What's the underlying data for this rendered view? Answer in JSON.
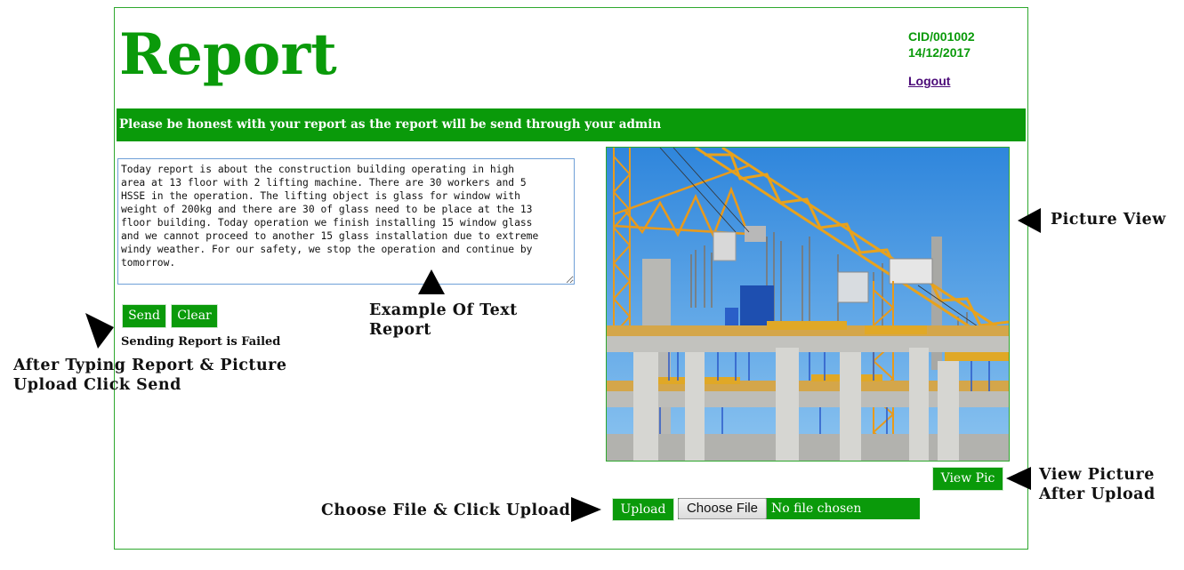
{
  "header": {
    "title": "Report",
    "cid": "CID/001002",
    "date": "14/12/2017",
    "logout_label": "Logout"
  },
  "banner": {
    "text": "Please be honest with your report as the report will be send through your admin"
  },
  "report": {
    "text": "Today report is about the construction building operating in high\narea at 13 floor with 2 lifting machine. There are 30 workers and 5\nHSSE in the operation. The lifting object is glass for window with\nweight of 200kg and there are 30 of glass need to be place at the 13\nfloor building. Today operation we finish installing 15 window glass\nand we cannot proceed to another 15 glass installation due to extreme\nwindy weather. For our safety, we stop the operation and continue by\ntomorrow."
  },
  "buttons": {
    "send_label": "Send",
    "clear_label": "Clear",
    "view_pic_label": "View Pic",
    "upload_label": "Upload",
    "choose_file_label": "Choose File"
  },
  "status": {
    "message": "Sending Report is Failed",
    "no_file_text": "No file chosen"
  },
  "annotations": {
    "after_typing_line1": "After Typing Report & Picture",
    "after_typing_line2": "Upload Click Send",
    "example_line1": "Example Of Text",
    "example_line2": "Report",
    "picture_view": "Picture View",
    "view_picture_line1": "View Picture",
    "view_picture_line2": "After Upload",
    "choose_file_upload": "Choose File & Click Upload"
  },
  "image": {
    "subject": "construction-site-with-cranes"
  },
  "colors": {
    "primary_green": "#0a9a0a",
    "logout_purple": "#4b0a78",
    "sky_blue": "#4a9ee6",
    "crane_orange": "#e89a1c"
  }
}
